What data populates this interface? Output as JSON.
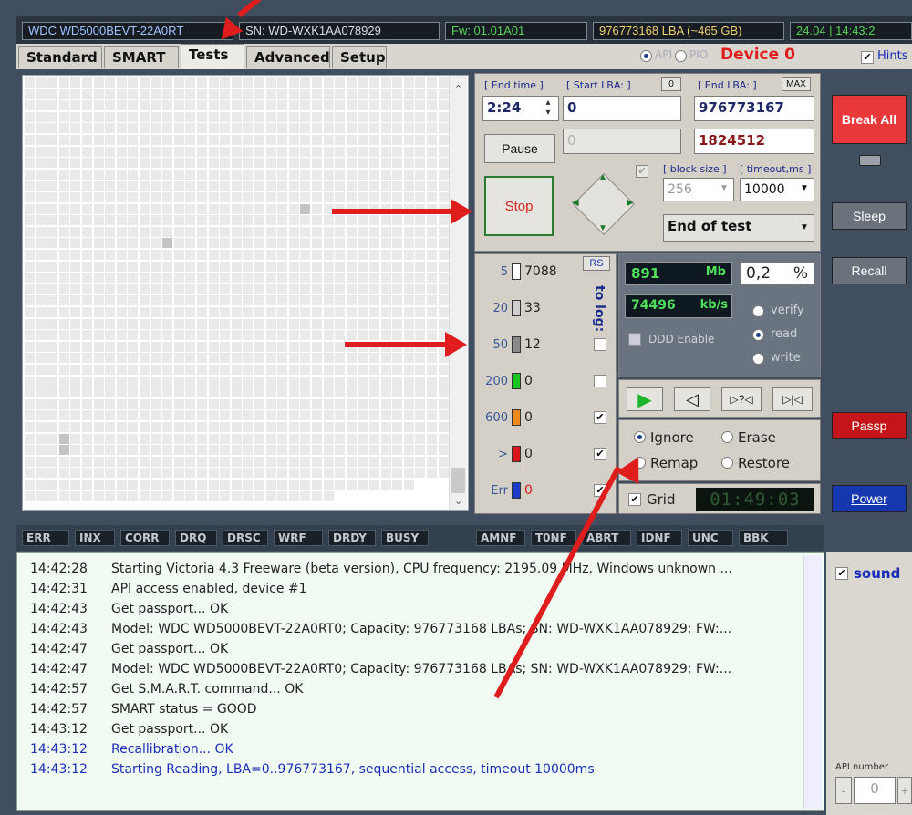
{
  "topbar": {
    "model": "WDC WD5000BEVT-22A0RT",
    "serial": "SN: WD-WXK1AA078929",
    "firmware": "Fw: 01.01A01",
    "lba": "976773168 LBA (~465 GB)",
    "clock": "24.04 | 14:43:2"
  },
  "tabs": [
    "Standard",
    "SMART",
    "Tests",
    "Advanced",
    "Setup"
  ],
  "mode": {
    "api_label": "API",
    "pio_label": "PIO",
    "device": "Device 0",
    "hints": "Hints"
  },
  "controls": {
    "end_time_label": "[ End time ]",
    "start_lba_label": "[ Start LBA: ]",
    "start_lba_zero": "0",
    "end_lba_label": "[ End LBA: ]",
    "max_label": "MAX",
    "end_time_value": "2:24",
    "start_lba_value": "0",
    "end_lba_value": "976773167",
    "current_lba_disabled": "0",
    "current_lba": "1824512",
    "pause": "Pause",
    "stop": "Stop",
    "block_size_label": "[ block size ]",
    "timeout_label": "[ timeout,ms ]",
    "block_size": "256",
    "timeout": "10000",
    "end_action": "End of test"
  },
  "blocks": {
    "rs": "RS",
    "to_log": "to log:",
    "rows": [
      {
        "label": "5",
        "count": "7088",
        "color": "#ffffff",
        "log": false
      },
      {
        "label": "20",
        "count": "33",
        "color": "#cfcfcf",
        "log": false
      },
      {
        "label": "50",
        "count": "12",
        "color": "#8a8a8a",
        "log": false
      },
      {
        "label": "200",
        "count": "0",
        "color": "#19c51d",
        "log": false
      },
      {
        "label": "600",
        "count": "0",
        "color": "#f08a1c",
        "log": true
      },
      {
        "label": ">",
        "count": "0",
        "color": "#d8141b",
        "log": true
      },
      {
        "label": "Err",
        "count": "0",
        "color": "#1a3cc8",
        "log": true
      }
    ]
  },
  "stats": {
    "mb": "891",
    "mb_unit": "Mb",
    "percent": "0,2",
    "percent_unit": "%",
    "speed": "74496",
    "speed_unit": "kb/s",
    "ddd": "DDD Enable",
    "verify": "verify",
    "read": "read",
    "write": "write",
    "transport": [
      "▶",
      "◁",
      "▷?◁",
      "▷|◁"
    ],
    "ignore": "Ignore",
    "erase": "Erase",
    "remap": "Remap",
    "restore": "Restore",
    "grid": "Grid",
    "timer": "01:49:03"
  },
  "side": {
    "break_all": "Break All",
    "sleep": "Sleep",
    "recall": "Recall",
    "passp": "Passp",
    "power": "Power",
    "sound": "sound",
    "api_number": "API number",
    "api_value": "0",
    "minus": "-",
    "plus": "+"
  },
  "status_flags": [
    "ERR",
    "INX",
    "CORR",
    "DRQ",
    "DRSC",
    "WRF",
    "DRDY",
    "BUSY",
    "AMNF",
    "T0NF",
    "ABRT",
    "IDNF",
    "UNC",
    "BBK"
  ],
  "log": [
    {
      "time": "14:42:28",
      "msg": "Starting Victoria 4.3 Freeware (beta version), CPU frequency: 2195.09 MHz, Windows unknown ...",
      "blue": false
    },
    {
      "time": "14:42:31",
      "msg": "API access enabled, device #1",
      "blue": false
    },
    {
      "time": "14:42:43",
      "msg": "Get passport... OK",
      "blue": false
    },
    {
      "time": "14:42:43",
      "msg": "Model: WDC WD5000BEVT-22A0RT0; Capacity: 976773168 LBAs; SN: WD-WXK1AA078929; FW:...",
      "blue": false
    },
    {
      "time": "14:42:47",
      "msg": "Get passport... OK",
      "blue": false
    },
    {
      "time": "14:42:47",
      "msg": "Model: WDC WD5000BEVT-22A0RT0; Capacity: 976773168 LBAs; SN: WD-WXK1AA078929; FW:...",
      "blue": false
    },
    {
      "time": "14:42:57",
      "msg": "Get S.M.A.R.T. command... OK",
      "blue": false
    },
    {
      "time": "14:42:57",
      "msg": "SMART status = GOOD",
      "blue": false
    },
    {
      "time": "14:43:12",
      "msg": "Get passport... OK",
      "blue": false
    },
    {
      "time": "14:43:12",
      "msg": "Recallibration... OK",
      "blue": true
    },
    {
      "time": "14:43:12",
      "msg": "Starting Reading, LBA=0..976773167, sequential access, timeout 10000ms",
      "blue": true
    }
  ]
}
